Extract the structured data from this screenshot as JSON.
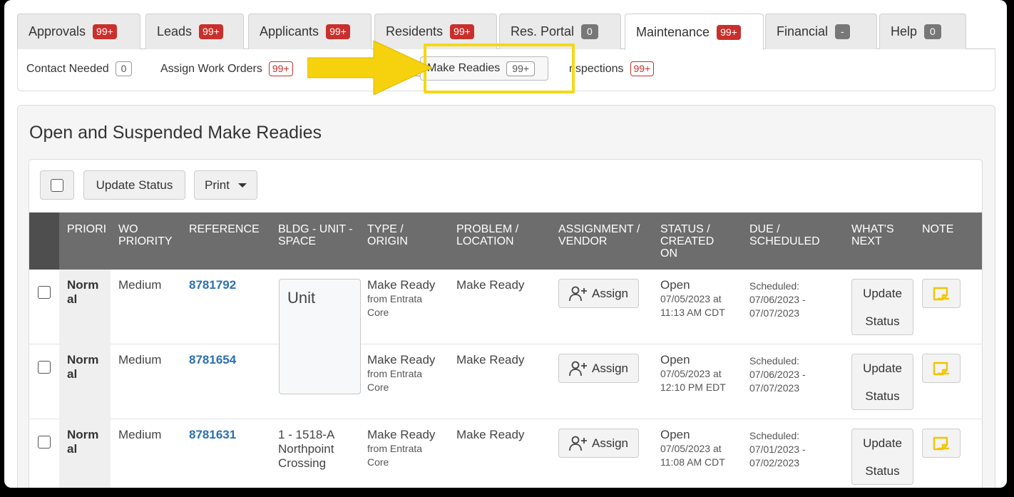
{
  "tabs": [
    {
      "label": "Approvals",
      "badge": "99+",
      "badge_type": "red"
    },
    {
      "label": "Leads",
      "badge": "99+",
      "badge_type": "red"
    },
    {
      "label": "Applicants",
      "badge": "99+",
      "badge_type": "red"
    },
    {
      "label": "Residents",
      "badge": "99+",
      "badge_type": "red"
    },
    {
      "label": "Res. Portal",
      "badge": "0",
      "badge_type": "gray"
    },
    {
      "label": "Maintenance",
      "badge": "99+",
      "badge_type": "red",
      "active": true
    },
    {
      "label": "Financial",
      "badge": "-",
      "badge_type": "gray"
    },
    {
      "label": "Help",
      "badge": "0",
      "badge_type": "gray"
    }
  ],
  "subtabs": {
    "contact_needed": {
      "label": "Contact Needed",
      "badge": "0"
    },
    "assign_work_orders": {
      "label": "Assign Work Orders",
      "badge": "99+"
    },
    "make_readies": {
      "label": "Make Readies",
      "badge": "99+",
      "active": true
    },
    "inspections": {
      "label": "nspections",
      "badge": "99+"
    }
  },
  "panel": {
    "title": "Open and Suspended Make Readies"
  },
  "toolbar": {
    "update_status": "Update Status",
    "print": "Print"
  },
  "columns": {
    "priority": "PRIORI",
    "wo_priority": "WO PRIORITY",
    "reference": "REFERENCE",
    "bldg": "BLDG - UNIT - SPACE",
    "type": "TYPE / ORIGIN",
    "problem": "PROBLEM / LOCATION",
    "assignment": "ASSIGNMENT / VENDOR",
    "status": "STATUS / CREATED ON",
    "due": "DUE / SCHEDULED",
    "whats_next": "WHAT'S NEXT",
    "note": "NOTE"
  },
  "unit_placeholder": "Unit",
  "rows": [
    {
      "priority_a": "Norm",
      "priority_b": "al",
      "wo_priority": "Medium",
      "reference": "8781792",
      "bldg": "",
      "type": "Make Ready",
      "origin_a": "from Entrata",
      "origin_b": "Core",
      "problem": "Make Ready",
      "assign": "Assign",
      "status": "Open",
      "created_a": "07/05/2023 at",
      "created_b": "11:13 AM CDT",
      "due_a": "Scheduled:",
      "due_b": "07/06/2023 -",
      "due_c": "07/07/2023",
      "next_a": "Update",
      "next_b": "Status"
    },
    {
      "priority_a": "Norm",
      "priority_b": "al",
      "wo_priority": "Medium",
      "reference": "8781654",
      "bldg": "",
      "type": "Make Ready",
      "origin_a": "from Entrata",
      "origin_b": "Core",
      "problem": "Make Ready",
      "assign": "Assign",
      "status": "Open",
      "created_a": "07/05/2023 at",
      "created_b": "12:10 PM EDT",
      "due_a": "Scheduled:",
      "due_b": "07/06/2023 -",
      "due_c": "07/07/2023",
      "next_a": "Update",
      "next_b": "Status"
    },
    {
      "priority_a": "Norm",
      "priority_b": "al",
      "wo_priority": "Medium",
      "reference": "8781631",
      "bldg_a": "1 - 1518-A",
      "bldg_b": "Northpoint",
      "bldg_c": "Crossing",
      "type": "Make Ready",
      "origin_a": "from Entrata",
      "origin_b": "Core",
      "problem": "Make Ready",
      "assign": "Assign",
      "status": "Open",
      "created_a": "07/05/2023 at",
      "created_b": "11:08 AM CDT",
      "due_a": "Scheduled:",
      "due_b": "07/01/2023 -",
      "due_c": "07/02/2023",
      "next_a": "Update",
      "next_b": "Status"
    }
  ],
  "colors": {
    "badge_red": "#c9302c",
    "badge_gray": "#777777",
    "header_bg": "#6d6d6d",
    "link": "#2a6fb0",
    "highlight": "#f5d814",
    "note_icon": "#f2c400"
  }
}
